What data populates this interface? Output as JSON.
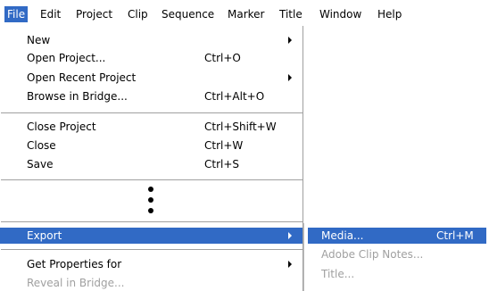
{
  "menubar": {
    "items": [
      "File",
      "Edit",
      "Project",
      "Clip",
      "Sequence",
      "Marker",
      "Title",
      "Window",
      "Help"
    ]
  },
  "file_menu": {
    "items": [
      {
        "label": "New",
        "shortcut": "",
        "submenu": true
      },
      {
        "label": "Open Project...",
        "shortcut": "Ctrl+O",
        "submenu": false
      },
      {
        "label": "Open Recent Project",
        "shortcut": "",
        "submenu": true
      },
      {
        "label": "Browse in Bridge...",
        "shortcut": "Ctrl+Alt+O",
        "submenu": false
      },
      {
        "label": "Close Project",
        "shortcut": "Ctrl+Shift+W",
        "submenu": false
      },
      {
        "label": "Close",
        "shortcut": "Ctrl+W",
        "submenu": false
      },
      {
        "label": "Save",
        "shortcut": "Ctrl+S",
        "submenu": false
      },
      {
        "label": "Export",
        "shortcut": "",
        "submenu": true,
        "highlighted": true
      },
      {
        "label": "Get Properties for",
        "shortcut": "",
        "submenu": true
      },
      {
        "label": "Reveal in Bridge...",
        "shortcut": "",
        "submenu": false,
        "disabled": true
      }
    ]
  },
  "export_submenu": {
    "items": [
      {
        "label": "Media...",
        "shortcut": "Ctrl+M",
        "highlighted": true
      },
      {
        "label": "Adobe Clip Notes...",
        "shortcut": "",
        "disabled": true
      },
      {
        "label": "Title...",
        "shortcut": "",
        "disabled": true
      }
    ]
  },
  "colors": {
    "highlight": "#316ac5",
    "disabled_text": "#a0a0a0"
  }
}
